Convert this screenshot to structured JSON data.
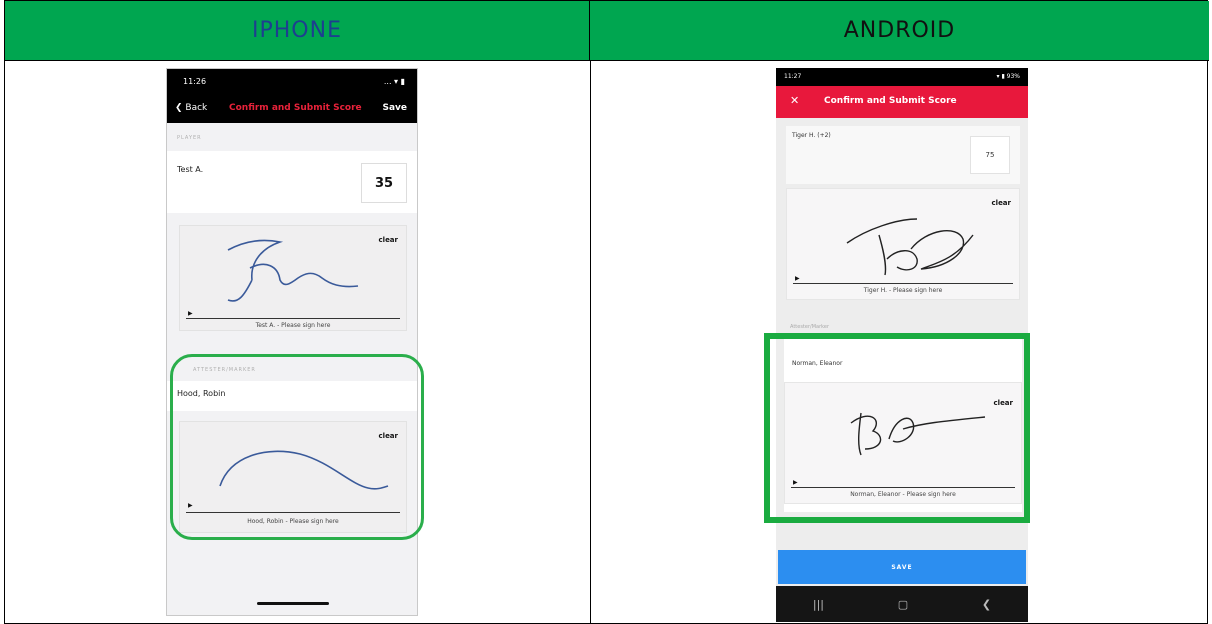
{
  "header": {
    "iphone_label": "IPHONE",
    "android_label": "ANDROID"
  },
  "colors": {
    "header_bg": "#00a650",
    "highlight": "#1aab40",
    "accent_red": "#e8183c",
    "save_blue": "#2c8ef0"
  },
  "iphone": {
    "status_time": "11:26",
    "status_icons": "...  ▾  ▮",
    "back_label": "❮ Back",
    "title": "Confirm and Submit Score",
    "save_label": "Save",
    "player_section": "PLAYER",
    "player_name": "Test A.",
    "player_score": "35",
    "clear_label": "clear",
    "player_sign_caption": "Test A. - Please sign here",
    "attester_section": "ATTESTER/MARKER",
    "attester_name": "Hood, Robin",
    "attester_sign_caption": "Hood, Robin - Please sign here",
    "arrow_icon": "▶"
  },
  "android": {
    "status_time": "11:27",
    "status_icons": "▾ ▮ 93%",
    "close_icon": "✕",
    "title": "Confirm and Submit Score",
    "player_name": "Tiger H. (+2)",
    "player_score": "75",
    "clear_label": "clear",
    "player_sign_caption": "Tiger H. - Please sign here",
    "attester_section": "Attester/Marker",
    "attester_name": "Norman, Eleanor",
    "attester_sign_caption": "Norman, Eleanor - Please sign here",
    "save_label": "SAVE",
    "nav_recent": "|||",
    "nav_home": "▢",
    "nav_back": "❮",
    "arrow_icon": "▶"
  }
}
